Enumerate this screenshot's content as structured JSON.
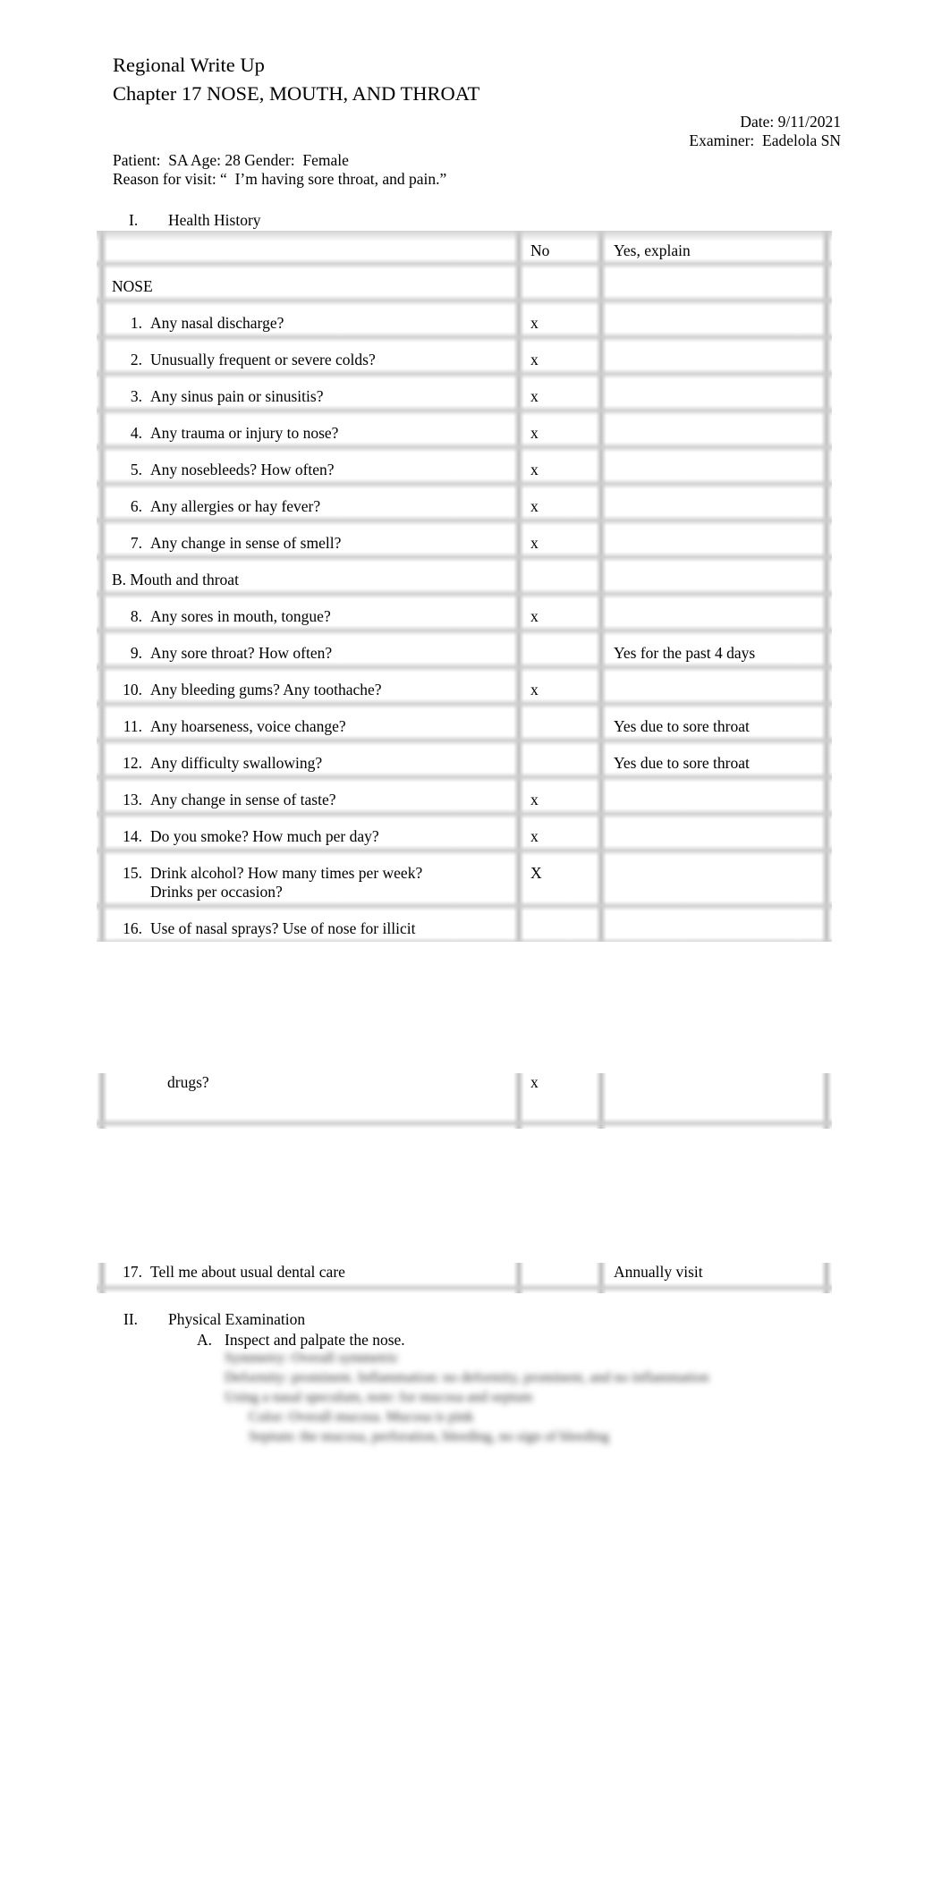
{
  "header": {
    "title": "Regional Write Up",
    "chapter": "Chapter 17 NOSE, MOUTH, AND THROAT",
    "date_label": "Date:",
    "date_value": "9/11/2021",
    "examiner_label": "Examiner:",
    "examiner_value": "Eadelola SN",
    "patient_line": "Patient:  SA Age: 28 Gender:  Female",
    "reason_line": "Reason for visit: “  I’m having sore throat, and pain.”"
  },
  "health_history": {
    "numeral": "I.",
    "title": "Health History",
    "columns": {
      "question": "",
      "no": "No",
      "yes": "Yes, explain"
    },
    "sections": {
      "nose": "NOSE",
      "mouth": "B. Mouth and throat"
    },
    "nose_questions": [
      {
        "num": "1.",
        "text": "Any nasal discharge?",
        "no": "x",
        "yes": ""
      },
      {
        "num": "2.",
        "text": "Unusually frequent or severe colds?",
        "no": "x",
        "yes": ""
      },
      {
        "num": "3.",
        "text": "Any sinus pain or sinusitis?",
        "no": "x",
        "yes": ""
      },
      {
        "num": "4.",
        "text": "Any trauma or injury to nose?",
        "no": "x",
        "yes": ""
      },
      {
        "num": "5.",
        "text": "Any nosebleeds? How often?",
        "no": "x",
        "yes": ""
      },
      {
        "num": "6.",
        "text": "Any allergies or hay fever?",
        "no": "x",
        "yes": ""
      },
      {
        "num": "7.",
        "text": "Any change in sense of smell?",
        "no": "x",
        "yes": ""
      }
    ],
    "mouth_questions": [
      {
        "num": "8.",
        "text": "Any sores in mouth, tongue?",
        "no": "x",
        "yes": ""
      },
      {
        "num": "9.",
        "text": "Any sore throat? How often?",
        "no": "",
        "yes": "Yes for the past 4 days"
      },
      {
        "num": "10.",
        "text": "Any bleeding gums? Any toothache?",
        "no": "x",
        "yes": ""
      },
      {
        "num": "11.",
        "text": "Any hoarseness, voice change?",
        "no": "",
        "yes": "Yes due to sore throat"
      },
      {
        "num": "12.",
        "text": "Any difficulty swallowing?",
        "no": "",
        "yes": "Yes due to sore throat"
      },
      {
        "num": "13.",
        "text": "Any change in sense of taste?",
        "no": "x",
        "yes": ""
      },
      {
        "num": "14.",
        "text": "Do you smoke? How much per day?",
        "no": "x",
        "yes": ""
      }
    ],
    "q15": {
      "num": "15.",
      "text_line1": "Drink alcohol? How many times per week?",
      "text_line2": "Drinks per occasion?",
      "no": "X",
      "yes": ""
    },
    "q16": {
      "num": "16.",
      "text_line1": "Use of nasal sprays? Use of nose for illicit",
      "text_line2": "drugs?",
      "no": "x",
      "yes": ""
    },
    "q17": {
      "num": "17.",
      "text": "Tell me about usual dental care",
      "no": "",
      "yes": "Annually visit"
    }
  },
  "physical_exam": {
    "numeral": "II.",
    "title": "Physical Examination",
    "item_a_letter": "A.",
    "item_a_text": "Inspect and palpate the nose.",
    "blurred_lines": [
      "Symmetry: Overall symmetric",
      "Deformity: prominent. Inflammation: no deformity, prominent, and no inflammation",
      "Using a nasal speculum, note: for mucosa and septum",
      "Color: Overall mucosa. Mucosa is pink",
      "Septum: the mucosa, perforation, bleeding, no sign of bleeding"
    ]
  }
}
